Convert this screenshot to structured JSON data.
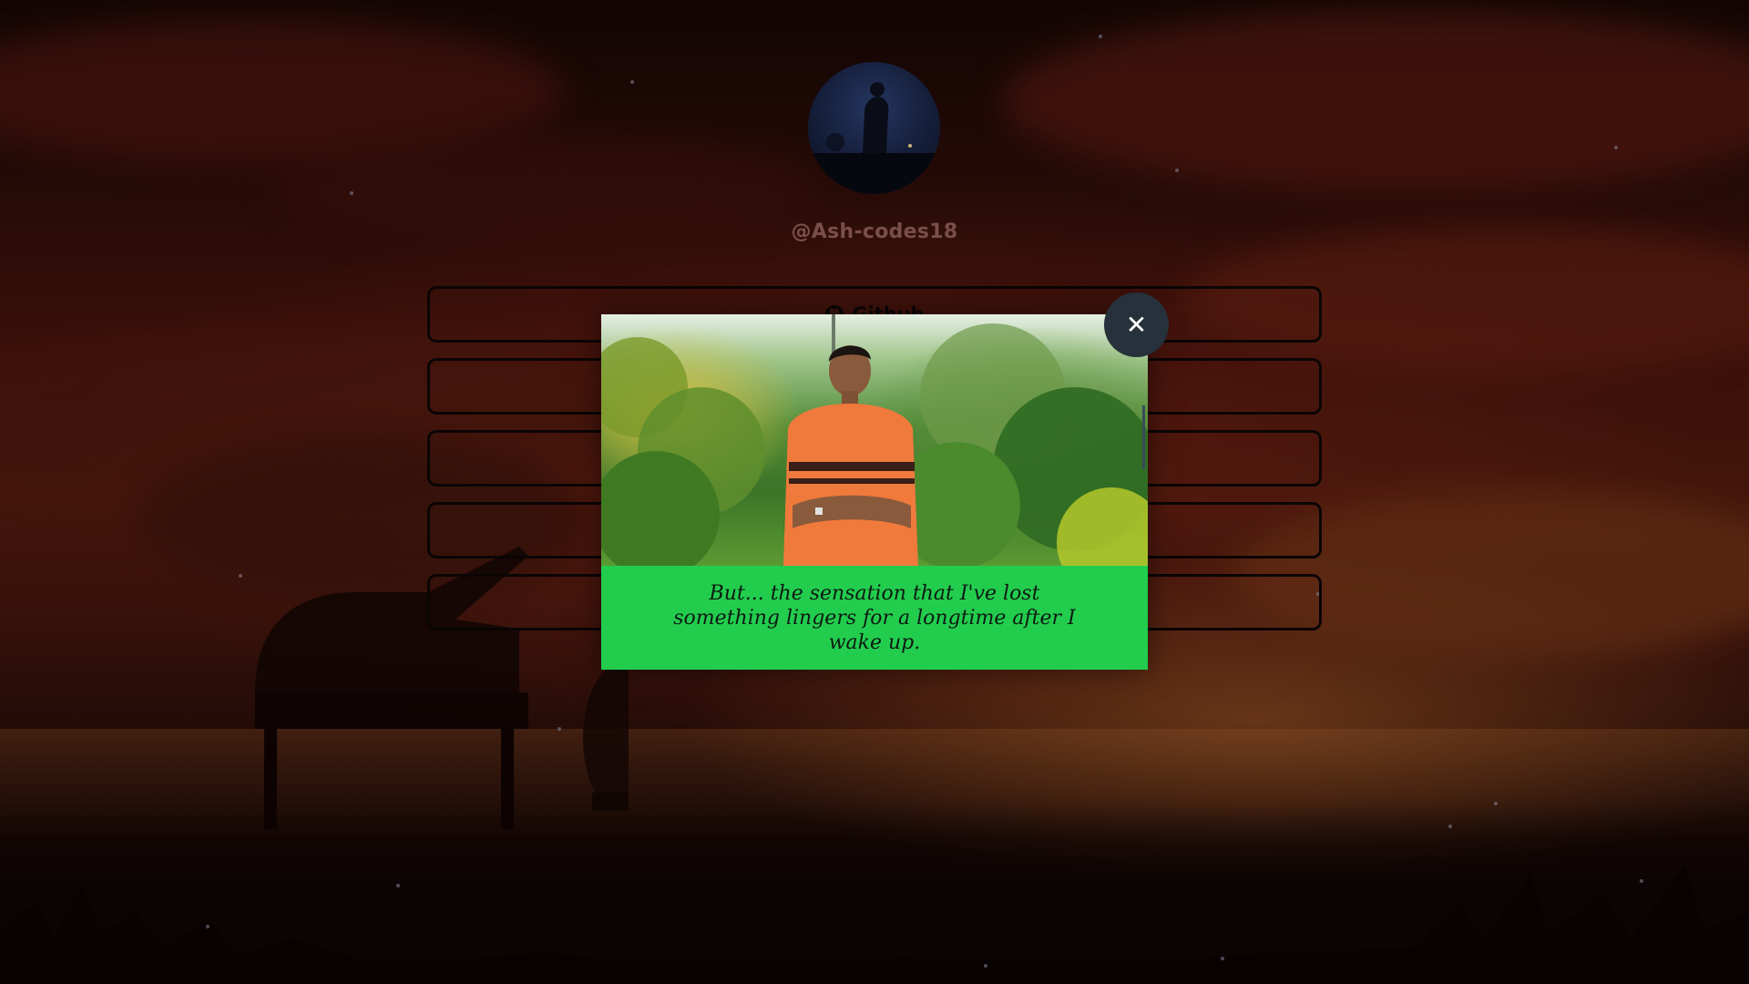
{
  "profile": {
    "username": "@Ash-codes18",
    "avatar_alt": "profile avatar"
  },
  "links": [
    {
      "label": "Github",
      "icon": "github-icon"
    },
    {
      "label": ""
    },
    {
      "label": ""
    },
    {
      "label": ""
    },
    {
      "label": ""
    }
  ],
  "modal": {
    "quote": "But... the sensation that I've lost something lingers for a longtime after I wake up.",
    "close_label": "✕",
    "accent_color": "#22cd4e",
    "close_bg_color": "#26313b"
  }
}
